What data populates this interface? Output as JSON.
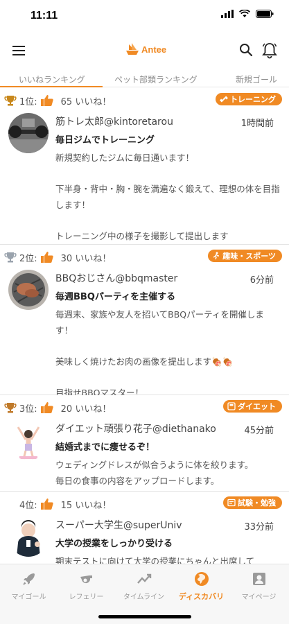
{
  "status_bar": {
    "time": "11:11"
  },
  "header": {
    "logo_text": "Antee"
  },
  "tabs": [
    {
      "label": "いいねランキング",
      "active": true
    },
    {
      "label": "ペット部類ランキング",
      "active": false
    },
    {
      "label": "新規ゴール",
      "active": false
    }
  ],
  "posts": [
    {
      "rank": "1位:",
      "likes": "65 いいね！",
      "badge": "トレーニング",
      "author": "筋トレ太郎@kintoretarou",
      "time": "1時間前",
      "title": "毎日ジムでトレーニング",
      "body": "新規契約したジムに毎日通います！\n\n下半身・背中・胸・腕を満遍なく鍛えて、理想の体を目指します！\n\nトレーニング中の様子を撮影して提出します"
    },
    {
      "rank": "2位:",
      "likes": "30 いいね！",
      "badge": "趣味・スポーツ",
      "author": "BBQおじさん@bbqmaster",
      "time": "6分前",
      "title": "毎週BBQパーティを主催する",
      "body": "毎週末、家族や友人を招いてBBQパーティを開催します！\n\n美味しく焼けたお肉の画像を提出します🍖🍖\n\n目指せBBQマスター！"
    },
    {
      "rank": "3位:",
      "likes": "20 いいね！",
      "badge": "ダイエット",
      "author": "ダイエット頑張り花子@diethanako",
      "time": "45分前",
      "title": "結婚式までに痩せるぞ！",
      "body": "ウェディングドレスが似合うように体を絞ります。\n毎日の食事の内容をアップロードします。"
    },
    {
      "rank": "4位:",
      "likes": "15 いいね！",
      "badge": "試験・勉強",
      "author": "スーパー大学生@superUniv",
      "time": "33分前",
      "title": "大学の授業をしっかり受ける",
      "body": "期末テストに向けて大学の授業にちゃんと出席して"
    }
  ],
  "bottom_nav": [
    {
      "label": "マイゴール",
      "icon": "rocket-icon",
      "active": false
    },
    {
      "label": "レフェリー",
      "icon": "whistle-icon",
      "active": false
    },
    {
      "label": "タイムライン",
      "icon": "trend-icon",
      "active": false
    },
    {
      "label": "ディスカバリ",
      "icon": "globe-icon",
      "active": true
    },
    {
      "label": "マイページ",
      "icon": "profile-icon",
      "active": false
    }
  ],
  "colors": {
    "accent": "#f08a24",
    "gold": "#c8881c",
    "silver": "#9aa3ad",
    "bronze": "#c07a2a"
  }
}
